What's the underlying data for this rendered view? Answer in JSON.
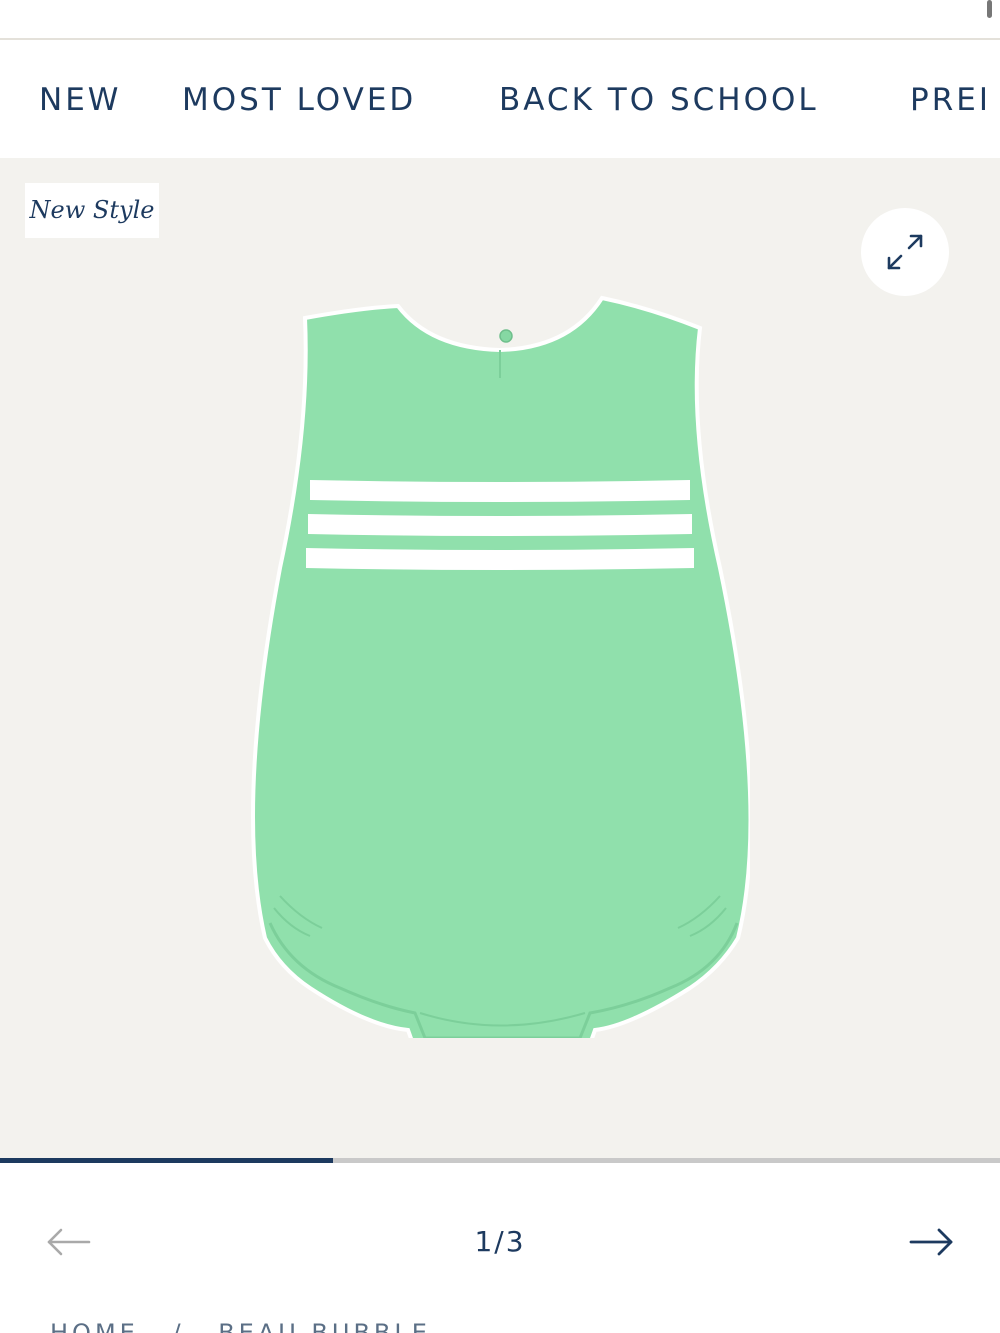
{
  "nav": {
    "items": [
      {
        "label": "NEW"
      },
      {
        "label": "MOST LOVED"
      },
      {
        "label": "BACK TO SCHOOL"
      },
      {
        "label": "PREI"
      }
    ]
  },
  "gallery": {
    "badge": "New Style",
    "expand_icon": "expand-arrows-icon",
    "product_image": "green-bubble-romper-with-white-stripes",
    "colors": {
      "background": "#f3f2ee",
      "garment": "#90e0ac",
      "stripe": "#ffffff",
      "accent": "#1d3a5f"
    }
  },
  "pager": {
    "progress": 0.3333,
    "counter": "1/3",
    "prev_icon": "arrow-left-icon",
    "next_icon": "arrow-right-icon"
  },
  "breadcrumb": {
    "home": "HOME",
    "separator": "/",
    "current": "BEAU BUBBLE"
  }
}
